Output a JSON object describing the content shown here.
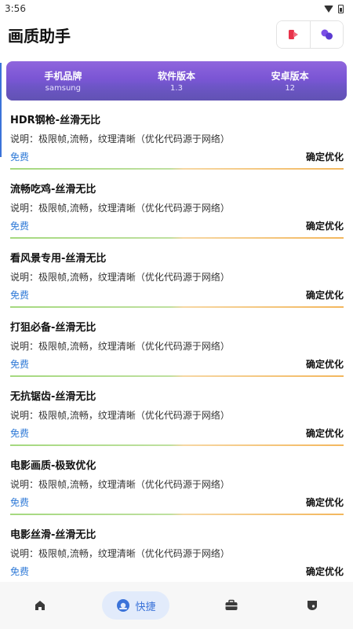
{
  "status_bar": {
    "time": "3:56"
  },
  "app_bar": {
    "title": "画质助手"
  },
  "device_info": [
    {
      "label": "手机品牌",
      "value": "samsung"
    },
    {
      "label": "软件版本",
      "value": "1.3"
    },
    {
      "label": "安卓版本",
      "value": "12"
    }
  ],
  "presets": [
    {
      "title": "HDR钢枪-丝滑无比",
      "desc": "说明：极限帧,流畅，纹理清晰（优化代码源于网络）",
      "price": "免费",
      "action": "确定优化"
    },
    {
      "title": "流畅吃鸡-丝滑无比",
      "desc": "说明：极限帧,流畅，纹理清晰（优化代码源于网络）",
      "price": "免费",
      "action": "确定优化"
    },
    {
      "title": "看风景专用-丝滑无比",
      "desc": "说明：极限帧,流畅，纹理清晰（优化代码源于网络）",
      "price": "免费",
      "action": "确定优化"
    },
    {
      "title": "打狙必备-丝滑无比",
      "desc": "说明：极限帧,流畅，纹理清晰（优化代码源于网络）",
      "price": "免费",
      "action": "确定优化"
    },
    {
      "title": "无抗锯齿-丝滑无比",
      "desc": "说明：极限帧,流畅，纹理清晰（优化代码源于网络）",
      "price": "免费",
      "action": "确定优化"
    },
    {
      "title": "电影画质-极致优化",
      "desc": "说明：极限帧,流畅，纹理清晰（优化代码源于网络）",
      "price": "免费",
      "action": "确定优化"
    },
    {
      "title": "电影丝滑-丝滑无比",
      "desc": "说明：极限帧,流畅，纹理清晰（优化代码源于网络）",
      "price": "免费",
      "action": "确定优化"
    }
  ],
  "bottom_nav": {
    "items": [
      {
        "icon": "home-icon",
        "label": ""
      },
      {
        "icon": "quick-icon",
        "label": "快捷"
      },
      {
        "icon": "toolbox-icon",
        "label": ""
      },
      {
        "icon": "profile-icon",
        "label": ""
      }
    ],
    "active_index": 1
  },
  "colors": {
    "accent": "#3b73d9",
    "banner": "#7a55d4",
    "price": "#2f7ad7",
    "divider_left": "#a5d97f",
    "divider_right": "#f3b75d",
    "header_red": "#e8334a",
    "header_purple": "#7b4ee6"
  }
}
